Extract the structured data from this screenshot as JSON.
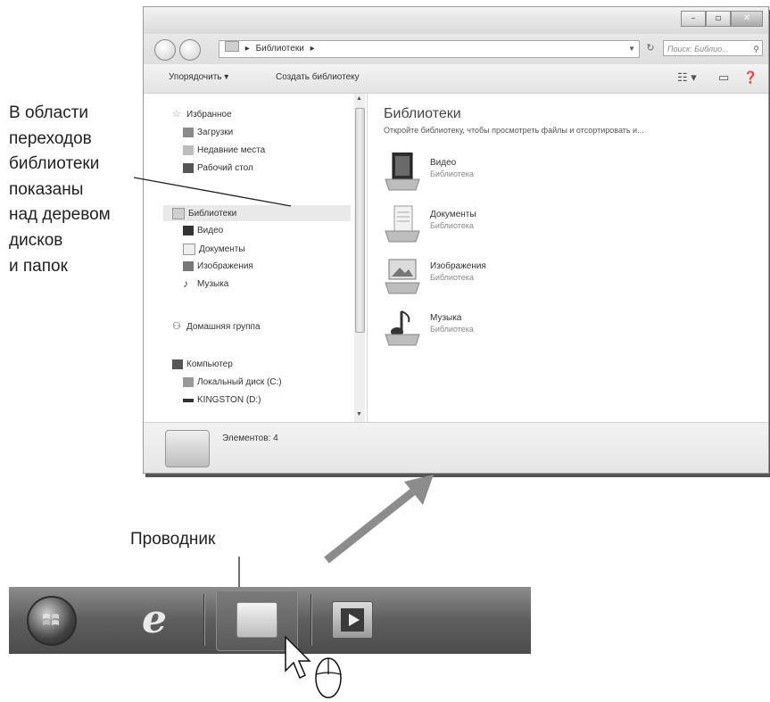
{
  "window": {
    "address": {
      "path_label": "Библиотеки",
      "sep": "▸"
    },
    "search_placeholder": "Поиск: Библио...",
    "toolbar": {
      "organize_label": "Упорядочить ▾",
      "create_library_label": "Создать библиотеку"
    },
    "navigation": {
      "favorites": "Избранное",
      "downloads": "Загрузки",
      "recent_places": "Недавние места",
      "desktop": "Рабочий стол",
      "libraries": "Библиотеки",
      "video": "Видео",
      "documents": "Документы",
      "images": "Изображения",
      "music": "Музыка",
      "homegroup": "Домашняя группа",
      "computer": "Компьютер",
      "local_disk": "Локальный диск (C:)",
      "kingston": "KINGSTON (D:)"
    },
    "content": {
      "title": "Библиотеки",
      "subtitle": "Откройте библиотеку, чтобы просмотреть файлы и отсортировать и...",
      "libraries": [
        {
          "name": "Видео",
          "type": "Библиотека"
        },
        {
          "name": "Документы",
          "type": "Библиотека"
        },
        {
          "name": "Изображения",
          "type": "Библиотека"
        },
        {
          "name": "Музыка",
          "type": "Библиотека"
        }
      ]
    },
    "status": "Элементов: 4"
  },
  "annotation": {
    "lines": [
      "В области",
      "переходов",
      "библиотеки",
      "показаны",
      "над деревом",
      "дисков",
      "и папок"
    ]
  },
  "taskbar": {
    "callout": "Проводник"
  },
  "colors": {
    "arrow": "#8c8c8c",
    "taskbar": "#5e5e5e",
    "window_bg": "#fbfbfb"
  }
}
